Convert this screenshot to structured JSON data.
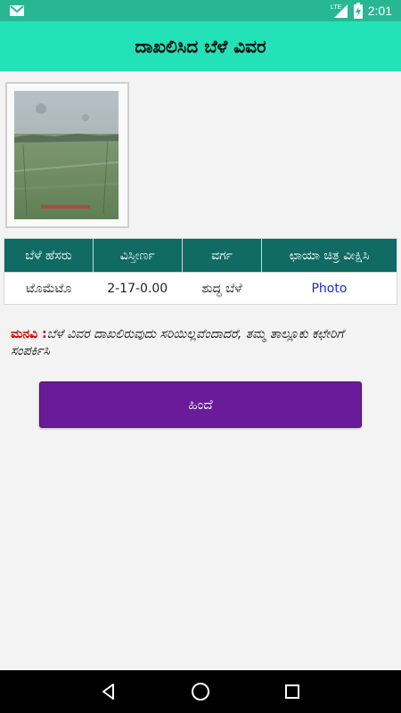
{
  "status_bar": {
    "time": "2:01",
    "network_label": "LTE",
    "icons": [
      "gmail-icon",
      "lte-signal-icon",
      "battery-charging-icon"
    ]
  },
  "header": {
    "title": "ದಾಖಲಿಸಿದ ಬೆಳೆ ವಿವರ"
  },
  "crop_table": {
    "headers": [
      "ಬೆಳೆ ಹೆಸರು",
      "ವಿಸ್ತೀರ್ಣ",
      "ವರ್ಗ",
      "ಛಾಯಾ ಚಿತ್ರ ವೀಕ್ಷಿಸಿ"
    ],
    "rows": [
      {
        "crop_name": "ಟೊಮೆಟೊ",
        "area": "2-17-0.00",
        "category": "ಶುದ್ಧ ಬೆಳೆ",
        "photo_link": "Photo"
      }
    ]
  },
  "notice": {
    "label": "ಮನವಿ :",
    "text": "ಬೆಳೆ ವಿವರ ದಾಖಲಿರುವುದು ಸರಿಯಿಲ್ಲವೆಂದಾದರೆ, ತಮ್ಮ ತಾಲ್ಲೂಕು ಕಛೇರಿಗೆ ಸಂಪರ್ಕಿಸಿ"
  },
  "back_button": {
    "label": "ಹಿಂದೆ"
  },
  "colors": {
    "status_bar": "#27b893",
    "app_bar": "#24e2b8",
    "table_header": "#0f6b64",
    "button": "#6a1b9a",
    "link": "#1a2bd6",
    "notice_label": "#d00000"
  }
}
